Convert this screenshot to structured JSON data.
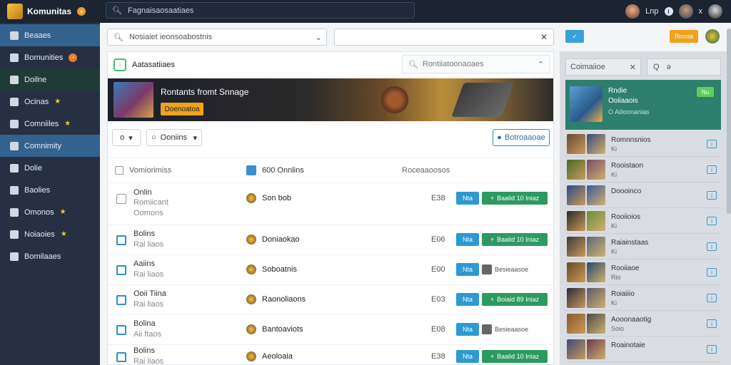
{
  "app": {
    "title": "Komunitas",
    "badge": "+"
  },
  "topbar": {
    "search_placeholder": "Fagnaisaosaatiaes",
    "user_label": "Lnp",
    "info_glyph": "i",
    "x_glyph": "x"
  },
  "sidebar": {
    "items": [
      {
        "label": "Beaaes"
      },
      {
        "label": "Bomunities",
        "badge": "+"
      },
      {
        "label": "Doilne"
      },
      {
        "label": "Ocinas",
        "star": "★"
      },
      {
        "label": "Comniiles",
        "star": "★"
      },
      {
        "label": "Comnimity"
      },
      {
        "label": "Dolie"
      },
      {
        "label": "Baolies"
      },
      {
        "label": "Omonos",
        "star": "★"
      },
      {
        "label": "Noiaoies",
        "star": "★"
      },
      {
        "label": "Bomilaaes"
      }
    ]
  },
  "filters": {
    "select_placeholder": "Nosiaiet ieonsoabostnis",
    "search_clear": "✕"
  },
  "panel": {
    "title": "Aatasatiiaes",
    "search_placeholder": "Rontiiatoonaoaes",
    "banner": {
      "title": "Rontants fromt Snnage",
      "button": "Doenoatoa"
    },
    "toolbar": {
      "btn1": "o",
      "btn2": "Ooniins",
      "btn3": "Botroaaoae"
    },
    "table": {
      "head": {
        "col1": "Vomiorimiss",
        "col2": "600 Onnlins",
        "col3": "Roceaaoosos"
      },
      "rows": [
        {
          "name": "Onlin",
          "sub": "Romiicant",
          "sub2": "Oomons",
          "game": "Son bob",
          "count": "E38",
          "b1": "Nta",
          "b2": "Baalid 10 Iniaz",
          "green": true
        },
        {
          "name": "Bolins",
          "sub": "Ral liaos",
          "game": "Doniaokao",
          "count": "E06",
          "b1": "Nta",
          "b2": "Baalid 10 Iniaz",
          "green": true
        },
        {
          "name": "Aaiins",
          "sub": "Rai liaos",
          "game": "Soboatnis",
          "count": "E00",
          "b1": "Nta",
          "b2": "Besieaasoe",
          "green": false
        },
        {
          "name": "Ooii Tiina",
          "sub": "Rai liaos",
          "game": "Raonoliaons",
          "count": "E03",
          "b1": "Nta",
          "b2": "Boiaid 89 Iniaz",
          "green": true
        },
        {
          "name": "Bolina",
          "sub": "Aii ftaos",
          "game": "Bantoaviots",
          "count": "E08",
          "b1": "Nta",
          "b2": "Besieaasoe",
          "green": false
        },
        {
          "name": "Bolins",
          "sub": "Rai liaos",
          "game": "Aeoloaia",
          "count": "E38",
          "b1": "Nta",
          "b2": "Baalid 10 Iniaz",
          "green": true
        }
      ]
    }
  },
  "right": {
    "btn1": "✓",
    "btn2": "Rmnia",
    "search_placeholder": "Coimaiioe",
    "search_clear": "✕",
    "filter_btn": "Q",
    "filter_glyph": "ə",
    "featured": {
      "t1": "Rndie",
      "t2": "Ooiiaaois",
      "t3": "O Aiiloonanias",
      "badge": "Nu"
    },
    "items": [
      {
        "name": "Romnnsnios",
        "sub": "Ki",
        "c1": "#6a4a3a",
        "c2": "#3a4a7a"
      },
      {
        "name": "Rooistaon",
        "sub": "Ki",
        "c1": "#4a6a2a",
        "c2": "#7a4a6a"
      },
      {
        "name": "Doooinco",
        "sub": "",
        "c1": "#2a4a8a",
        "c2": "#3a5a9a"
      },
      {
        "name": "Rooiioios",
        "sub": "Ki",
        "c1": "#2a2a2a",
        "c2": "#6a8a3a"
      },
      {
        "name": "Raiainstaas",
        "sub": "Ki",
        "c1": "#3a3a3a",
        "c2": "#5a6a7a"
      },
      {
        "name": "Rooiiaoe",
        "sub": "Rio",
        "c1": "#6a4a2a",
        "c2": "#2a4a6a"
      },
      {
        "name": "Roiaiiio",
        "sub": "Ki",
        "c1": "#2a2a3a",
        "c2": "#5a5a6a"
      },
      {
        "name": "Aooonaaotig",
        "sub": "Soio",
        "c1": "#8a5a2a",
        "c2": "#4a4a4a"
      },
      {
        "name": "Roainotaie",
        "sub": "",
        "c1": "#3a4a7a",
        "c2": "#6a3a4a"
      }
    ]
  }
}
